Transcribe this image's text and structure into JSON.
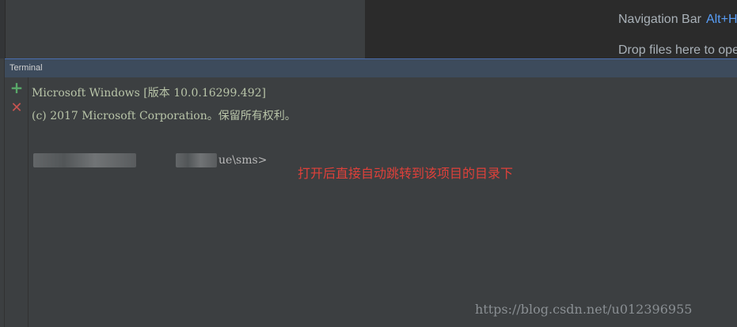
{
  "welcome": {
    "navigation_label": "Navigation Bar",
    "navigation_shortcut": "Alt+Home",
    "drop_text": "Drop files here to open"
  },
  "terminal": {
    "title": "Terminal",
    "toolbar": {
      "add_icon": "plus-icon",
      "close_icon": "close-icon"
    },
    "lines": [
      "Microsoft Windows [版本 10.0.16299.492]",
      "(c) 2017 Microsoft Corporation。保留所有权利。"
    ],
    "prompt_suffix": "ue\\sms>"
  },
  "annotation": "打开后直接自动跳转到该项目的目录下",
  "watermark": "https://blog.csdn.net/u012396955",
  "colors": {
    "add": "#59a869",
    "close": "#c75450",
    "annotation": "#e0403a",
    "header": "#3d4b5c"
  }
}
